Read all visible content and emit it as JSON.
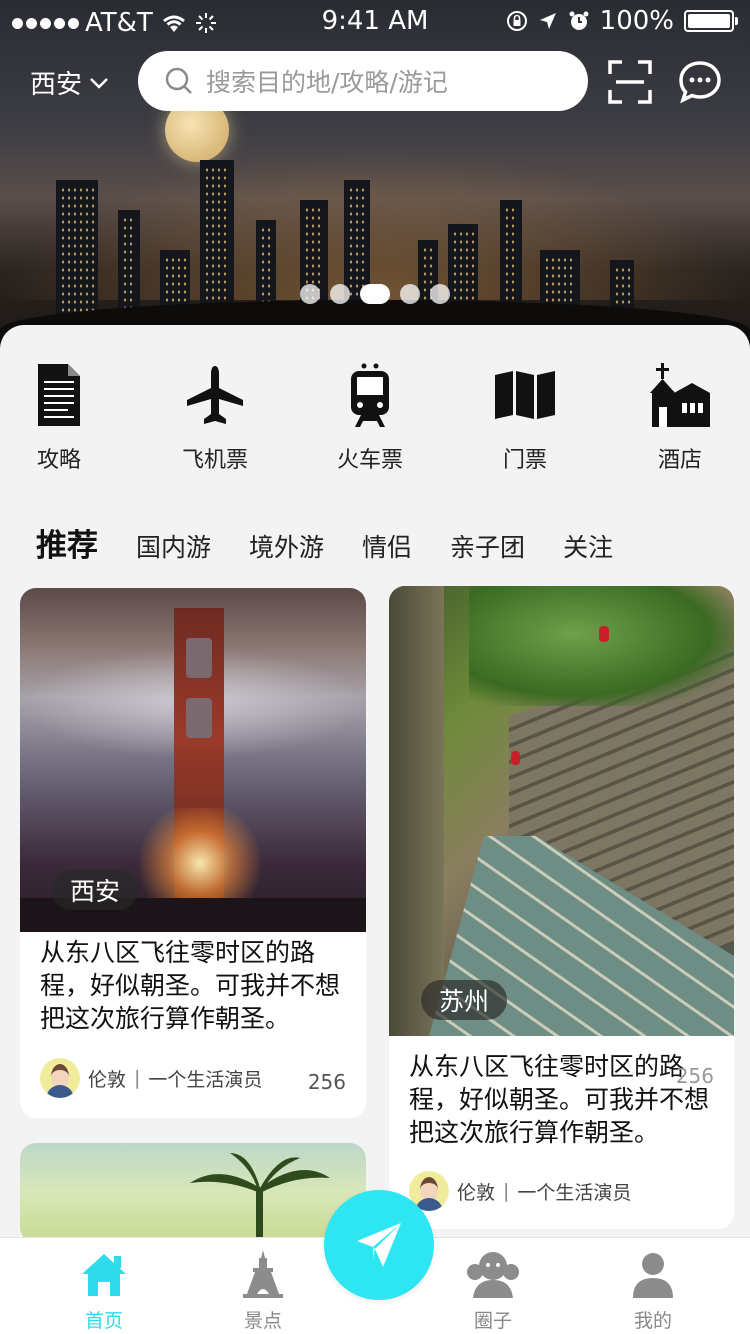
{
  "status_bar": {
    "carrier": "AT&T",
    "time": "9:41 AM",
    "battery": "100%",
    "icons": [
      "signal-dots-icon",
      "wifi-icon",
      "activity-spinner-icon",
      "rotation-lock-icon",
      "location-icon",
      "alarm-icon",
      "battery-icon"
    ]
  },
  "header": {
    "city": "西安",
    "search_placeholder": "搜索目的地/攻略/游记",
    "icons": [
      "chevron-down-icon",
      "search-icon",
      "scan-icon",
      "message-icon"
    ]
  },
  "banner": {
    "page_count": 5,
    "active_index": 2
  },
  "quick_actions": [
    {
      "label": "攻略",
      "icon": "guide-document-icon"
    },
    {
      "label": "飞机票",
      "icon": "airplane-icon"
    },
    {
      "label": "火车票",
      "icon": "train-icon"
    },
    {
      "label": "门票",
      "icon": "map-ticket-icon"
    },
    {
      "label": "酒店",
      "icon": "hotel-church-icon"
    }
  ],
  "tabs": [
    "推荐",
    "国内游",
    "境外游",
    "情侣",
    "亲子团",
    "关注"
  ],
  "active_tab": 0,
  "cards": [
    {
      "tag": "西安",
      "text": "从东八区飞往零时区的路程，好似朝圣。可我并不想把这次旅行算作朝圣。",
      "author": "伦敦",
      "role": "一个生活演员",
      "count": "256"
    },
    {
      "tag": "苏州",
      "text": "从东八区飞往零时区的路程，好似朝圣。可我并不想把这次旅行算作朝圣。",
      "author": "伦敦",
      "role": "一个生活演员",
      "count": "256"
    }
  ],
  "bottom_nav": [
    {
      "label": "首页",
      "icon": "home-icon"
    },
    {
      "label": "景点",
      "icon": "tower-icon"
    },
    {
      "label": "圈子",
      "icon": "group-icon"
    },
    {
      "label": "我的",
      "icon": "user-icon"
    }
  ],
  "fab_icon": "paper-plane-icon",
  "colors": {
    "accent": "#2ee6f1",
    "active_text": "#2edbeb",
    "inactive_icon": "#8c8c8c"
  }
}
